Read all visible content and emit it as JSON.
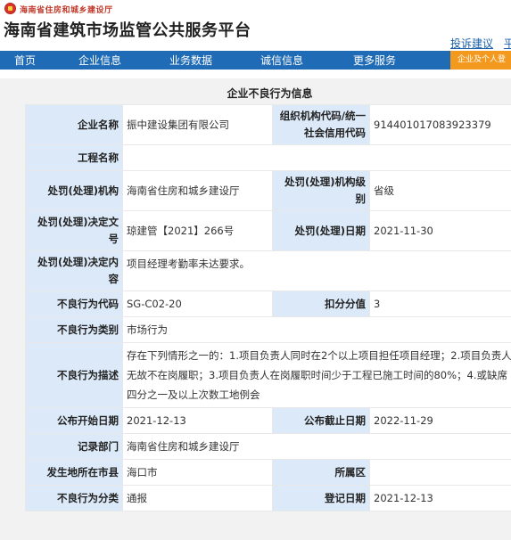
{
  "header": {
    "department": "海南省住房和城乡建设厅",
    "site_title": "海南省建筑市场监管公共服务平台",
    "links": [
      "投诉建议",
      "平"
    ]
  },
  "nav": {
    "items": [
      "首页",
      "企业信息",
      "业务数据",
      "诚信信息",
      "更多服务"
    ],
    "login_button": "企业及个人登"
  },
  "record": {
    "title": "企业不良行为信息",
    "company_name_label": "企业名称",
    "company_name": "振中建设集团有限公司",
    "org_code_label": "组织机构代码/统一社会信用代码",
    "org_code": "914401017083923379",
    "project_label": "工程名称",
    "project": "",
    "authority_label": "处罚(处理)机构",
    "authority": "海南省住房和城乡建设厅",
    "authority_level_label": "处罚(处理)机构级别",
    "authority_level": "省级",
    "decision_no_label": "处罚(处理)决定文号",
    "decision_no": "琼建管【2021】266号",
    "decision_date_label": "处罚(处理)日期",
    "decision_date": "2021-11-30",
    "decision_content_label": "处罚(处理)决定内容",
    "decision_content": "项目经理考勤率未达要求。",
    "code_label": "不良行为代码",
    "code": "SG-C02-20",
    "score_label": "扣分分值",
    "score": "3",
    "category_label": "不良行为类别",
    "category": "市场行为",
    "description_label": "不良行为描述",
    "description": "存在下列情形之一的：1.项目负责人同时在2个以上项目担任项目经理；2.项目负责人无故不在岗履职；3.项目负责人在岗履职时间少于工程已施工时间的80%；4.或缺席四分之一及以上次数工地例会",
    "publish_start_label": "公布开始日期",
    "publish_start": "2021-12-13",
    "publish_end_label": "公布截止日期",
    "publish_end": "2022-11-29",
    "recorder_label": "记录部门",
    "recorder": "海南省住房和城乡建设厅",
    "city_label": "发生地所在市县",
    "city": "海口市",
    "district_label": "所属区",
    "district": "",
    "classification_label": "不良行为分类",
    "classification": "通报",
    "register_date_label": "登记日期",
    "register_date": "2021-12-13"
  }
}
